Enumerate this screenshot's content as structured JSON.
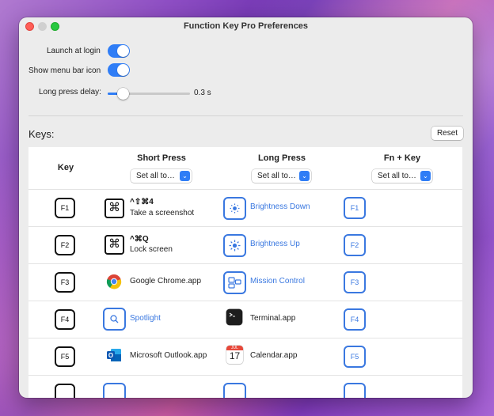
{
  "window": {
    "title": "Function Key Pro Preferences"
  },
  "settings": {
    "launch_at_login": {
      "label": "Launch at login",
      "on": true
    },
    "show_menu_bar_icon": {
      "label": "Show menu bar icon",
      "on": true
    },
    "long_press_delay": {
      "label": "Long press delay:",
      "value_text": "0.3 s",
      "fraction": 0.15
    }
  },
  "keys_section": {
    "heading": "Keys:",
    "reset_label": "Reset",
    "columns": {
      "key": "Key",
      "short_press": "Short Press",
      "long_press": "Long Press",
      "fn_key": "Fn + Key"
    },
    "set_all_label": "Set all to…",
    "rows": [
      {
        "key": "F1",
        "short_combo": "^⇧⌘4",
        "short_label": "Take a screenshot",
        "short_icon": "command-icon",
        "long_label": "Brightness Down",
        "long_icon": "brightness-down-icon",
        "fn": "F1"
      },
      {
        "key": "F2",
        "short_combo": "^⌘Q",
        "short_label": "Lock screen",
        "short_icon": "command-icon",
        "long_label": "Brightness Up",
        "long_icon": "brightness-up-icon",
        "fn": "F2"
      },
      {
        "key": "F3",
        "short_label": "Google Chrome.app",
        "short_icon": "chrome-icon",
        "long_label": "Mission Control",
        "long_icon": "mission-control-icon",
        "fn": "F3"
      },
      {
        "key": "F4",
        "short_label": "Spotlight",
        "short_icon": "search-icon",
        "long_label": "Terminal.app",
        "long_icon": "terminal-icon",
        "fn": "F4"
      },
      {
        "key": "F5",
        "short_label": "Microsoft Outlook.app",
        "short_icon": "outlook-icon",
        "long_label": "Calendar.app",
        "long_icon": "calendar-icon",
        "fn": "F5"
      }
    ],
    "calendar_icon": {
      "month": "JUL",
      "day": "17"
    }
  },
  "colors": {
    "accent": "#2f7df6",
    "link_blue": "#3a78e0"
  }
}
